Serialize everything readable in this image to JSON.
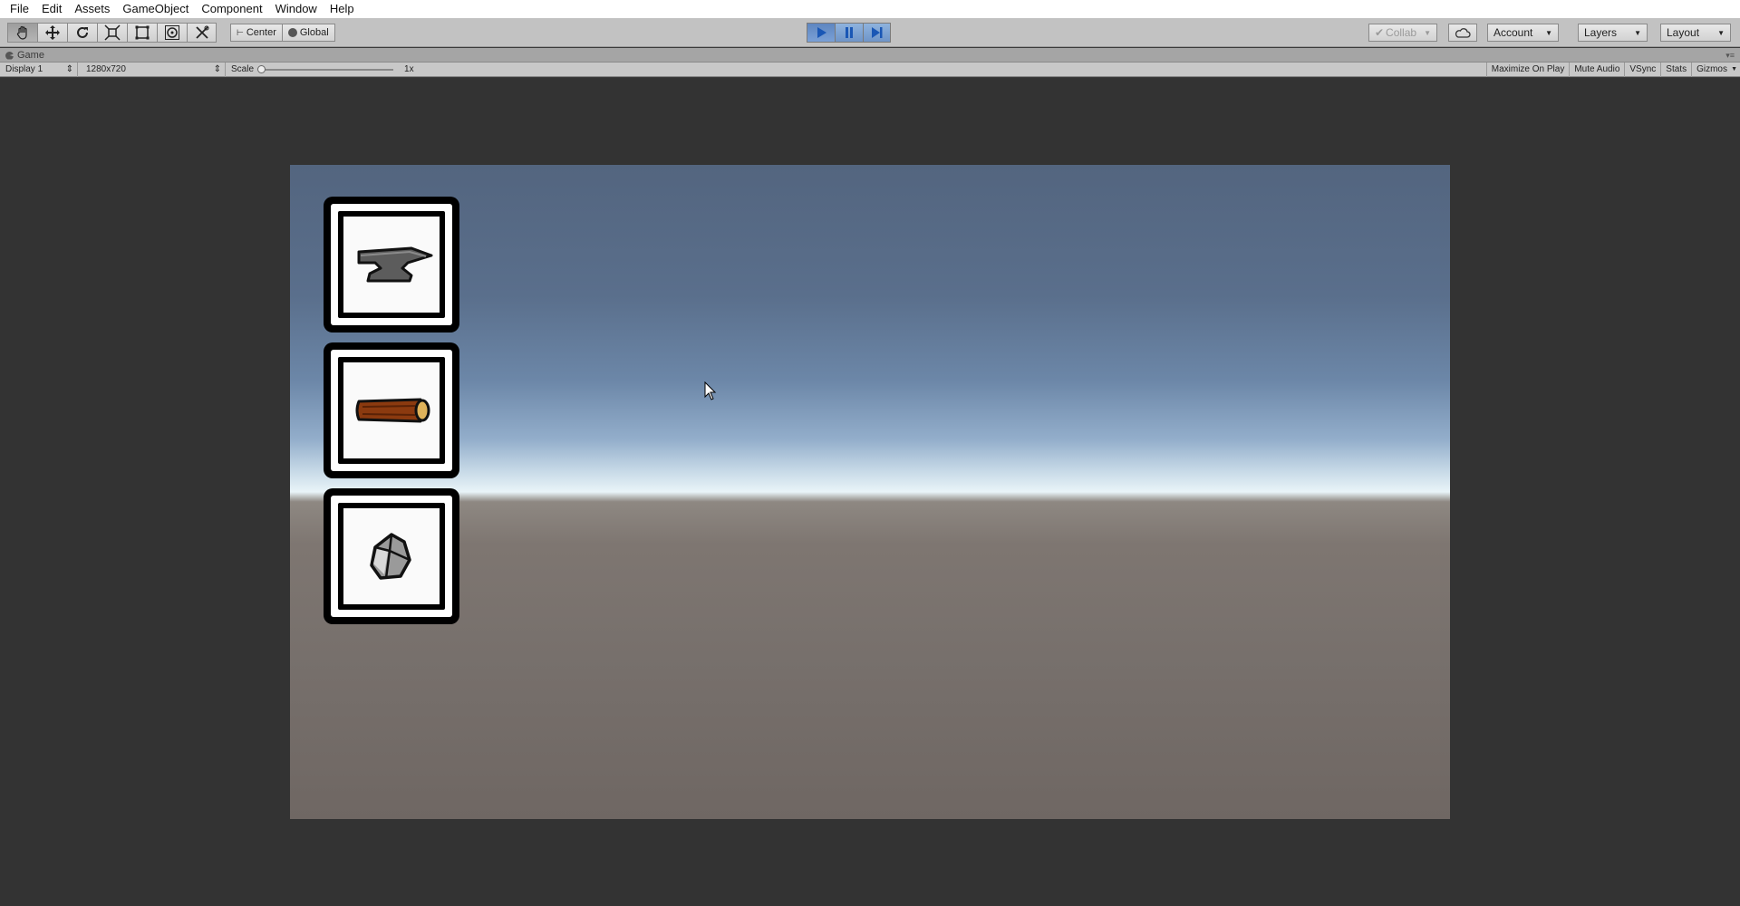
{
  "menu": [
    "File",
    "Edit",
    "Assets",
    "GameObject",
    "Component",
    "Window",
    "Help"
  ],
  "toolbar": {
    "tools": [
      "hand-tool",
      "move-tool",
      "rotate-tool",
      "scale-tool",
      "rect-tool",
      "transform-tool",
      "custom-tool"
    ],
    "pivot_mode": "Center",
    "pivot_rotation": "Global",
    "collab": "Collab",
    "account": "Account",
    "layers": "Layers",
    "layout": "Layout"
  },
  "game_tab": {
    "title": "Game"
  },
  "game_bar": {
    "display": "Display 1",
    "resolution": "1280x720",
    "scale_label": "Scale",
    "scale_value": "1x",
    "maximize": "Maximize On Play",
    "mute": "Mute Audio",
    "vsync": "VSync",
    "stats": "Stats",
    "gizmos": "Gizmos"
  },
  "inventory": {
    "slots": [
      {
        "item": "anvil-icon",
        "color": "#5a5a5a"
      },
      {
        "item": "log-icon",
        "color": "#8b3a0f"
      },
      {
        "item": "rock-icon",
        "color": "#9a9a9a"
      }
    ]
  },
  "colors": {
    "play_active": "#5e86c0",
    "sky_top": "#53657f",
    "horizon": "#e9f4f8",
    "ground": "#7e7671",
    "editor_bg": "#333333"
  }
}
